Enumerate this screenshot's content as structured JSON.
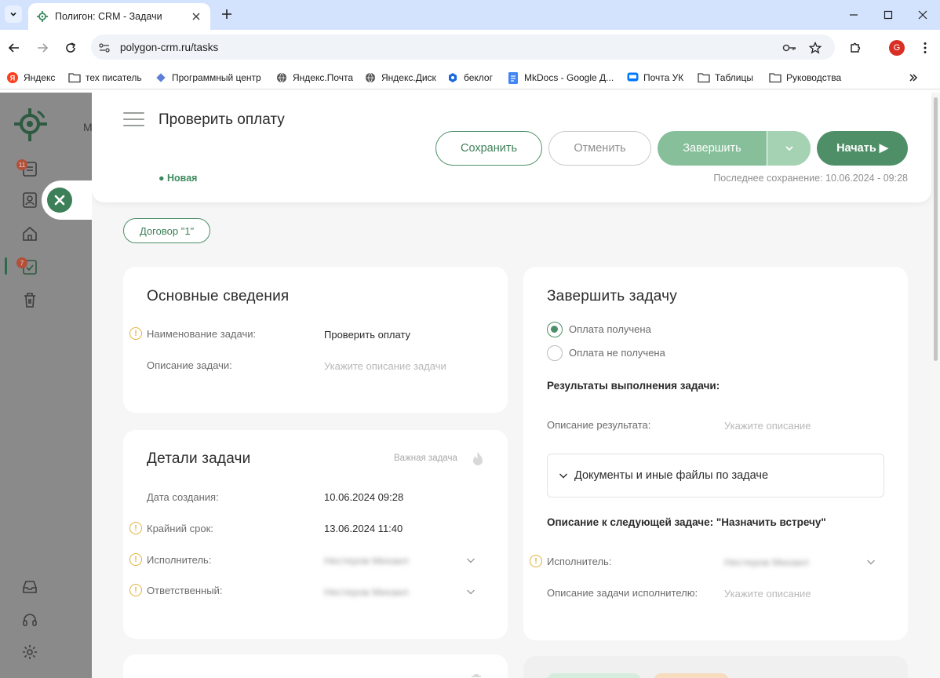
{
  "browser": {
    "tab_title": "Полигон: CRM - Задачи",
    "url": "polygon-crm.ru/tasks",
    "profile_initial": "G",
    "bookmarks": [
      {
        "label": "Яндекс",
        "icon": "yandex-icon"
      },
      {
        "label": "тех писатель",
        "icon": "folder-icon"
      },
      {
        "label": "Программный центр",
        "icon": "diamond-icon"
      },
      {
        "label": "Яндекс.Почта",
        "icon": "globe-icon"
      },
      {
        "label": "Яндекс.Диск",
        "icon": "globe-icon"
      },
      {
        "label": "беклог",
        "icon": "app-icon"
      },
      {
        "label": "MkDocs - Google Д...",
        "icon": "doc-icon"
      },
      {
        "label": "Почта УК",
        "icon": "mail-icon"
      },
      {
        "label": "Таблицы",
        "icon": "folder-icon"
      },
      {
        "label": "Руководства",
        "icon": "folder-icon"
      }
    ]
  },
  "app_bg": {
    "text_fragment": "М",
    "rail_badges": [
      "11",
      "7"
    ]
  },
  "drawer": {
    "title": "Проверить оплату",
    "status": "● Новая",
    "last_saved": "Последнее сохранение: 10.06.2024 - 09:28",
    "buttons": {
      "save": "Сохранить",
      "cancel": "Отменить",
      "finish": "Завершить",
      "start": "Начать ▶"
    },
    "contract_chip": "Договор \"1\""
  },
  "basic_info": {
    "title": "Основные сведения",
    "task_name_label": "Наименование задачи:",
    "task_name_value": "Проверить оплату",
    "description_label": "Описание задачи:",
    "description_placeholder": "Укажите описание задачи"
  },
  "task_details": {
    "title": "Детали задачи",
    "important_label": "Важная задача",
    "created_label": "Дата создания:",
    "created_value": "10.06.2024  09:28",
    "deadline_label": "Крайний срок:",
    "deadline_value": "13.06.2024  11:40",
    "executor_label": "Исполнитель:",
    "executor_value": "Нестеров Михаил",
    "responsible_label": "Ответственный:",
    "responsible_value": "Нестеров Михаил"
  },
  "complete_task": {
    "title": "Завершить задачу",
    "options": [
      {
        "label": "Оплата получена",
        "checked": true
      },
      {
        "label": "Оплата не получена",
        "checked": false
      }
    ],
    "results_heading": "Результаты выполнения задачи:",
    "result_desc_label": "Описание результата:",
    "result_desc_placeholder": "Укажите описание",
    "documents_accordion": "Документы и иные файлы по задаче",
    "next_task_heading": "Описание к следующей задаче: \"Назначить встречу\"",
    "next_executor_label": "Исполнитель:",
    "next_executor_value": "Нестеров Михаил",
    "next_desc_label": "Описание задачи исполнителю:",
    "next_desc_placeholder": "Укажите описание"
  },
  "colors": {
    "accent": "#4f8f68",
    "accent_light": "#86bf99",
    "warning": "#e2b23c",
    "tab_bar": "#d3e3fd"
  }
}
